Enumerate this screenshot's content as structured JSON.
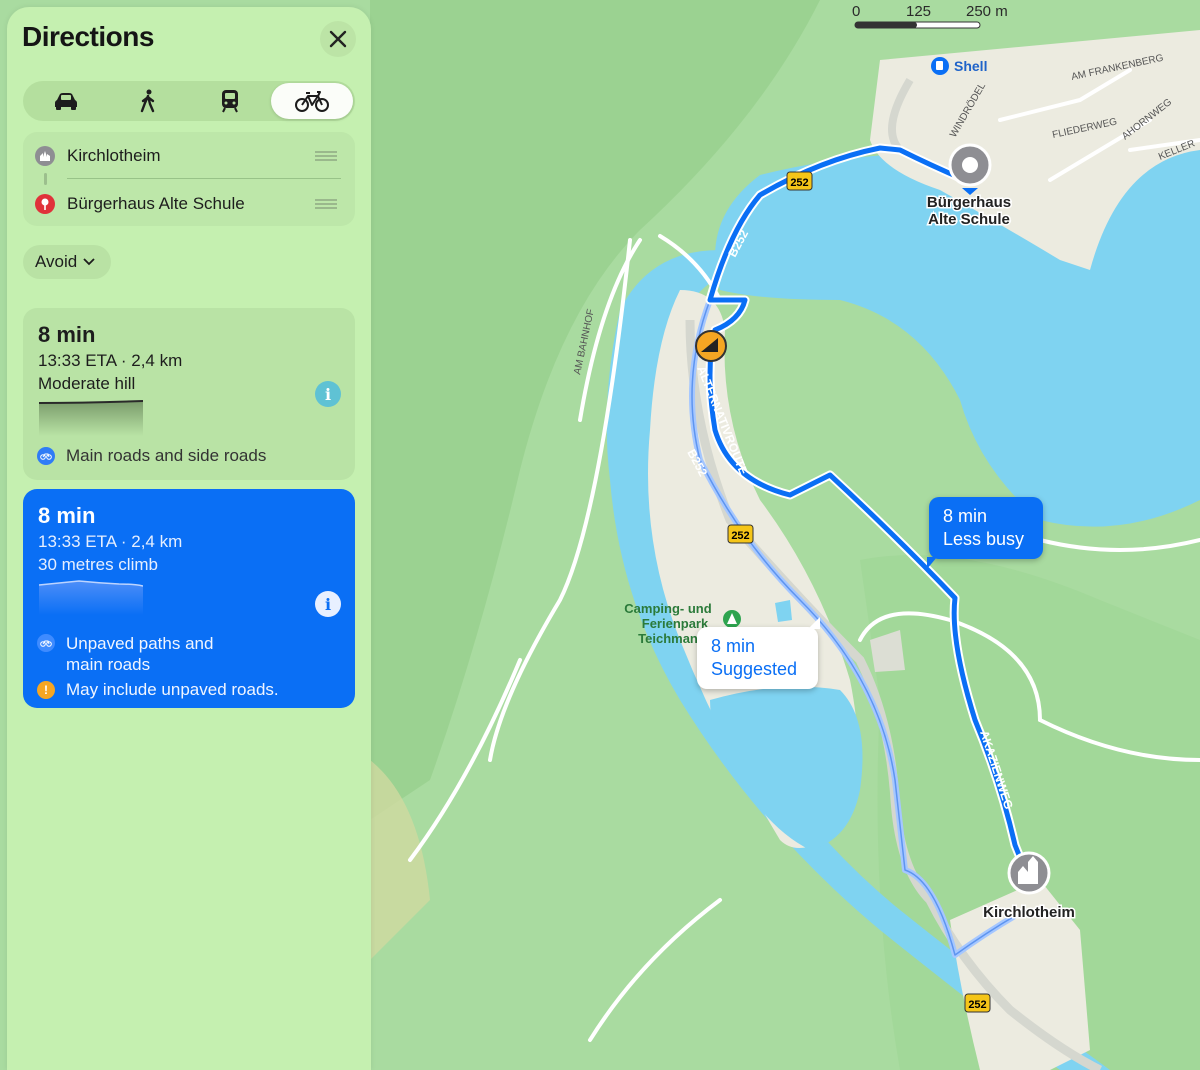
{
  "sidebar": {
    "title": "Directions",
    "close_icon": "close-icon",
    "modes": [
      {
        "name": "car",
        "icon": "car-icon",
        "active": false
      },
      {
        "name": "walk",
        "icon": "walk-icon",
        "active": false
      },
      {
        "name": "transit",
        "icon": "train-icon",
        "active": false
      },
      {
        "name": "bike",
        "icon": "bike-icon",
        "active": true
      }
    ],
    "waypoints": [
      {
        "label": "Kirchlotheim",
        "icon": "town-icon"
      },
      {
        "label": "Bürgerhaus Alte Schule",
        "icon": "pin-icon"
      }
    ],
    "avoid_label": "Avoid",
    "routes": [
      {
        "time": "8 min",
        "eta": "13:33 ETA · 2,4 km",
        "climb": "Moderate hill",
        "details": [
          "Main roads and side roads"
        ],
        "selected": false
      },
      {
        "time": "8 min",
        "eta": "13:33 ETA · 2,4 km",
        "climb": "30 metres climb",
        "details": [
          "Unpaved paths and\nmain roads",
          "May include unpaved roads."
        ],
        "selected": true
      }
    ]
  },
  "map": {
    "scale": {
      "zero": "0",
      "mid": "125",
      "end": "250 m"
    },
    "callouts": {
      "busy": {
        "time": "8 min",
        "note": "Less busy"
      },
      "suggested": {
        "time": "8 min",
        "note": "Suggested"
      }
    },
    "places": {
      "destination": [
        "Bürgerhaus",
        "Alte Schule"
      ],
      "origin": "Kirchlotheim",
      "shell": "Shell",
      "camping": [
        "Camping- und",
        "Ferienpark",
        "Teichmann"
      ]
    },
    "streets": {
      "frankenberg": "AM FRANKENBERG",
      "windrodel": "WINDRÖDEL",
      "fliederweg": "FLIEDERWEG",
      "ahornweg": "AHORNWEG",
      "keller": "KELLER",
      "bahnhof": "AM BAHNHOF",
      "alternativroute": "ALTERNATIVROUTE",
      "b252": "B252",
      "akazienweg": "AKAZIENWEG"
    },
    "road_shield": "252",
    "colors": {
      "route": "#0a6ff5",
      "water": "#7fd3f1",
      "land": "#a9dba0"
    }
  }
}
